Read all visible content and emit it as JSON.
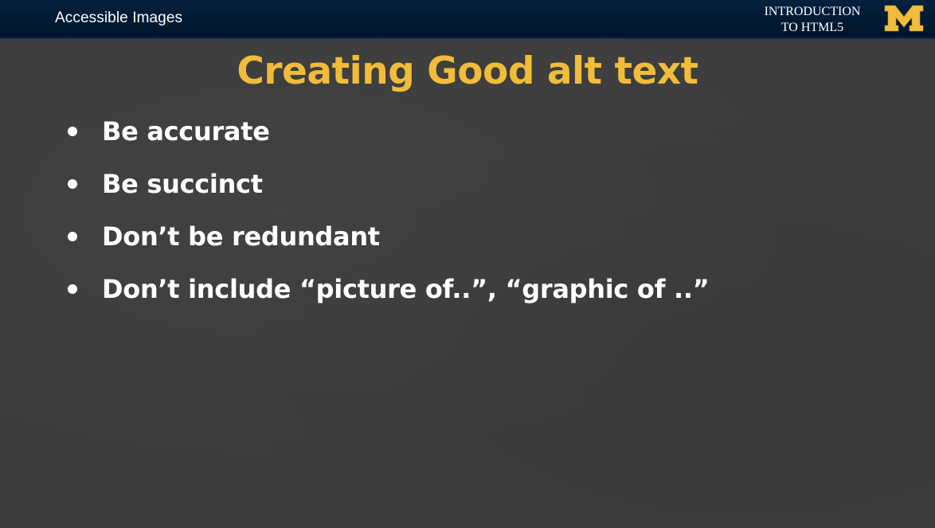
{
  "header": {
    "title": "Accessible Images",
    "course_line1": "INTRODUCTION",
    "course_line2": "TO HTML5",
    "logo_letter": "M"
  },
  "slide": {
    "title": "Creating Good alt text",
    "bullets": [
      "Be accurate",
      "Be succinct",
      "Don’t be redundant",
      "Don’t include “picture of..”, “graphic of ..”"
    ]
  },
  "colors": {
    "header_bg": "#00274c",
    "maize": "#f0bc3a",
    "slide_bg": "#3d3d3d",
    "text": "#ffffff"
  },
  "icons": {
    "logo": "block-m-logo",
    "bullet": "bullet-dot-icon"
  }
}
